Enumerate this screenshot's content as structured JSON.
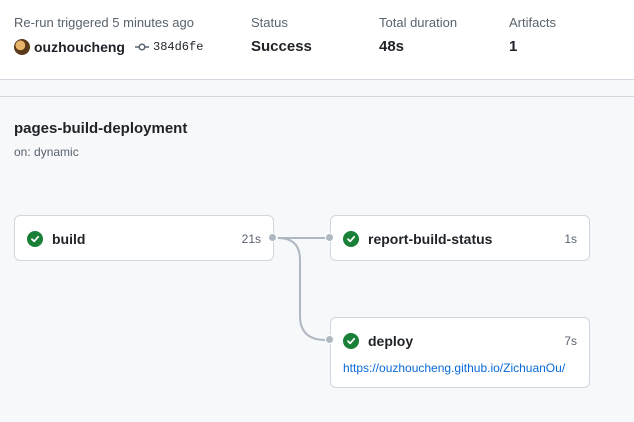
{
  "summary": {
    "trigger_label": "Re-run triggered 5 minutes ago",
    "actor": "ouzhoucheng",
    "commit_sha": "384d6fe",
    "status_label": "Status",
    "status_value": "Success",
    "duration_label": "Total duration",
    "duration_value": "48s",
    "artifacts_label": "Artifacts",
    "artifacts_value": "1"
  },
  "workflow": {
    "name": "pages-build-deployment",
    "trigger": "on: dynamic"
  },
  "jobs": [
    {
      "name": "build",
      "duration": "21s",
      "status": "success"
    },
    {
      "name": "report-build-status",
      "duration": "1s",
      "status": "success"
    },
    {
      "name": "deploy",
      "duration": "7s",
      "status": "success",
      "link": "https://ouzhoucheng.github.io/ZichuanOu/"
    }
  ],
  "colors": {
    "success": "#1a7f37",
    "link": "#0969da",
    "connector": "#afb8c1"
  },
  "icons": [
    "avatar",
    "commit-icon",
    "check-circle-icon"
  ]
}
